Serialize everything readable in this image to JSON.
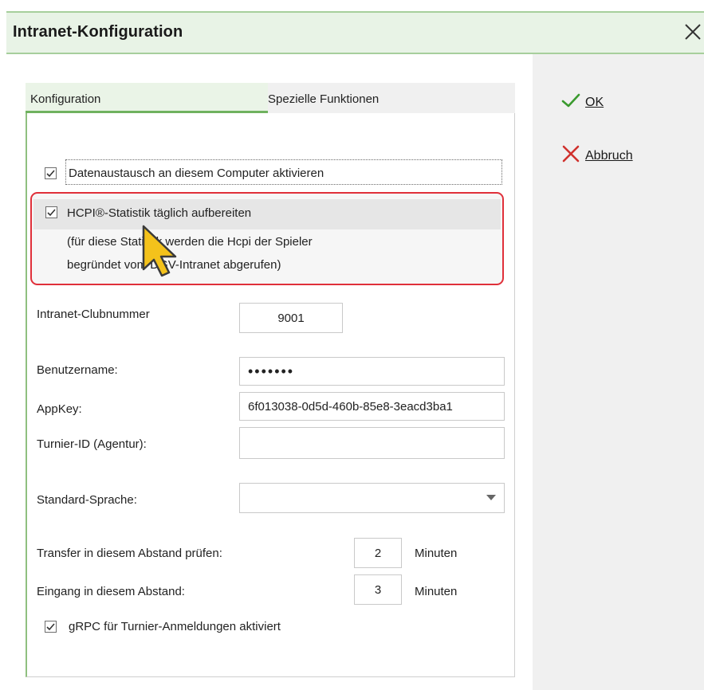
{
  "window": {
    "title": "Intranet-Konfiguration"
  },
  "actions": {
    "ok_label": "OK",
    "cancel_label": "Abbruch",
    "ok_color": "#3a9a2e",
    "cancel_color": "#d0312d"
  },
  "tabs": [
    {
      "label": "Konfiguration",
      "active": true
    },
    {
      "label": "Spezielle Funktionen",
      "active": false
    }
  ],
  "form": {
    "datenaustausch": {
      "label": "Datenaustausch an diesem Computer aktivieren",
      "checked": true
    },
    "hcpi": {
      "label": "HCPI®-Statistik täglich aufbereiten",
      "note_line1": "(für diese Statistik werden die Hcpi der Spieler",
      "note_line2": "begründet vom DGV-Intranet abgerufen)",
      "checked": true
    },
    "clubnummer": {
      "label": "Intranet-Clubnummer",
      "value": "9001"
    },
    "benutzername": {
      "label": "Benutzername:",
      "value": "•••••••"
    },
    "appkey": {
      "label": "AppKey:",
      "value": "6f013038-0d5d-460b-85e8-3eacd3ba1"
    },
    "turnier_id": {
      "label": "Turnier-ID (Agentur):",
      "value": ""
    },
    "sprache": {
      "label": "Standard-Sprache:",
      "value": ""
    },
    "transfer": {
      "label": "Transfer in diesem Abstand prüfen:",
      "value": "2",
      "unit": "Minuten"
    },
    "eingang": {
      "label": "Eingang in diesem Abstand:",
      "value": "3",
      "unit": "Minuten"
    },
    "grpc": {
      "label": "gRPC für Turnier-Anmeldungen aktiviert",
      "checked": true
    }
  },
  "colors": {
    "accent_green": "#8fc07f",
    "highlight_red": "#e0303a",
    "cursor_yellow": "#f4c21b"
  }
}
